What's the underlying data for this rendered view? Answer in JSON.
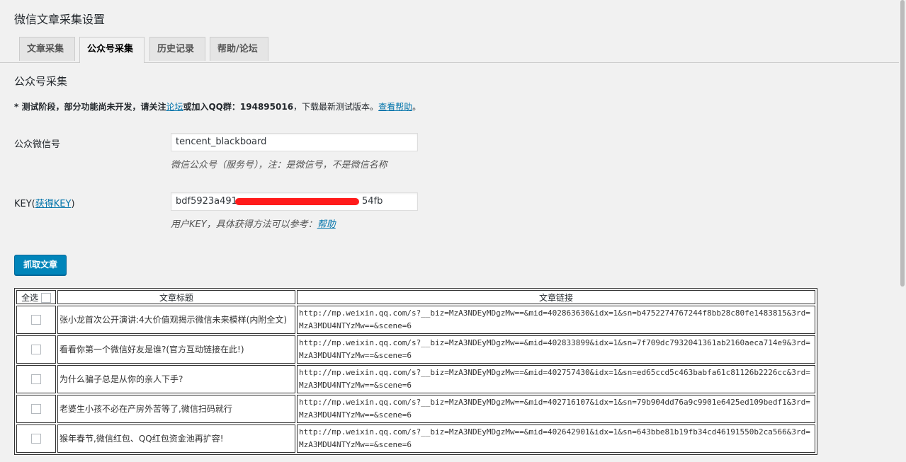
{
  "page_title": "微信文章采集设置",
  "tabs": [
    {
      "label": "文章采集",
      "active": false
    },
    {
      "label": "公众号采集",
      "active": true
    },
    {
      "label": "历史记录",
      "active": false
    },
    {
      "label": "帮助/论坛",
      "active": false
    }
  ],
  "section_title": "公众号采集",
  "notice": {
    "prefix": "* 测试阶段，部分功能尚未开发，请关注",
    "forum_link": "论坛",
    "middle": "或加入QQ群：",
    "qq_group": "194895016",
    "suffix_before_link": "，下载最新测试版本。",
    "help_link": "查看帮助",
    "end": "。"
  },
  "account_field": {
    "label": "公众微信号",
    "value": "tencent_blackboard",
    "description": "微信公众号（服务号），注：是微信号，不是微信名称"
  },
  "key_field": {
    "label_prefix": "KEY(",
    "label_link": "获得KEY",
    "label_suffix": ")",
    "value_start": "bdf5923a491",
    "value_end": "54fb",
    "description_prefix": "用户KEY，具体获得方法可以参考：",
    "description_link": "帮助"
  },
  "fetch_button": "抓取文章",
  "table": {
    "headers": {
      "select_all": "全选",
      "title": "文章标题",
      "link": "文章链接"
    },
    "rows": [
      {
        "title": "张小龙首次公开演讲:4大价值观揭示微信未来模样(内附全文)",
        "link": "http://mp.weixin.qq.com/s?__biz=MzA3NDEyMDgzMw==&mid=402863630&idx=1&sn=b4752274767244f8bb28c80fe1483815&3rd=MzA3MDU4NTYzMw==&scene=6"
      },
      {
        "title": "看看你第一个微信好友是谁?(官方互动链接在此!)",
        "link": "http://mp.weixin.qq.com/s?__biz=MzA3NDEyMDgzMw==&mid=402833899&idx=1&sn=7f709dc7932041361ab2160aeca714e9&3rd=MzA3MDU4NTYzMw==&scene=6"
      },
      {
        "title": "为什么骗子总是从你的亲人下手?",
        "link": "http://mp.weixin.qq.com/s?__biz=MzA3NDEyMDgzMw==&mid=402757430&idx=1&sn=ed65ccd5c463babfa61c81126b2226cc&3rd=MzA3MDU4NTYzMw==&scene=6"
      },
      {
        "title": "老婆生小孩不必在产房外苦等了,微信扫码就行",
        "link": "http://mp.weixin.qq.com/s?__biz=MzA3NDEyMDgzMw==&mid=402716107&idx=1&sn=79b904dd76a9c9901e6425ed109bedf1&3rd=MzA3MDU4NTYzMw==&scene=6"
      },
      {
        "title": "猴年春节,微信红包、QQ红包资金池再扩容!",
        "link": "http://mp.weixin.qq.com/s?__biz=MzA3NDEyMDgzMw==&mid=402642901&idx=1&sn=643bbe81b19fb34cd46191550b2ca566&3rd=MzA3MDU4NTYzMw==&scene=6"
      }
    ]
  }
}
